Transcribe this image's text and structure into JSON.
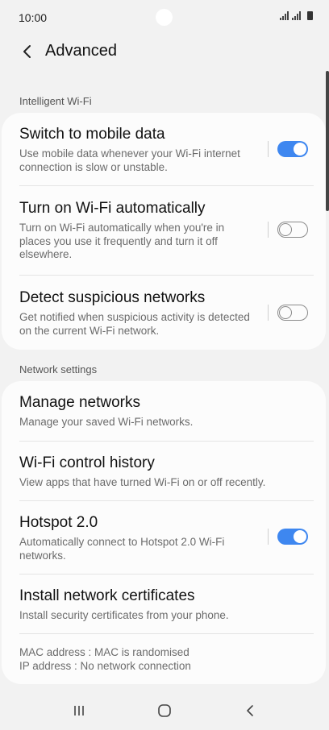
{
  "status_bar": {
    "time": "10:00"
  },
  "app_bar": {
    "title": "Advanced"
  },
  "sections": {
    "intelligent_wifi": "Intelligent Wi-Fi",
    "network_settings": "Network settings"
  },
  "intelligent_items": [
    {
      "title": "Switch to mobile data",
      "subtitle": "Use mobile data whenever your Wi-Fi internet connection is slow or unstable.",
      "toggle": "on"
    },
    {
      "title": "Turn on Wi-Fi automatically",
      "subtitle": "Turn on Wi-Fi automatically when you're in places you use it frequently and turn it off elsewhere.",
      "toggle": "off"
    },
    {
      "title": "Detect suspicious networks",
      "subtitle": "Get notified when suspicious activity is detected on the current Wi-Fi network.",
      "toggle": "off"
    }
  ],
  "network_items": [
    {
      "title": "Manage networks",
      "subtitle": "Manage your saved Wi-Fi networks."
    },
    {
      "title": "Wi-Fi control history",
      "subtitle": "View apps that have turned Wi-Fi on or off recently."
    },
    {
      "title": "Hotspot 2.0",
      "subtitle": "Automatically connect to Hotspot 2.0 Wi-Fi networks.",
      "toggle": "on"
    },
    {
      "title": "Install network certificates",
      "subtitle": "Install security certificates from your phone."
    }
  ],
  "info": {
    "mac": "MAC address : MAC is randomised",
    "ip": "IP address : No network connection"
  },
  "colors": {
    "accent": "#3e87f0",
    "background": "#f2f2f2",
    "card": "#fcfcfc"
  }
}
